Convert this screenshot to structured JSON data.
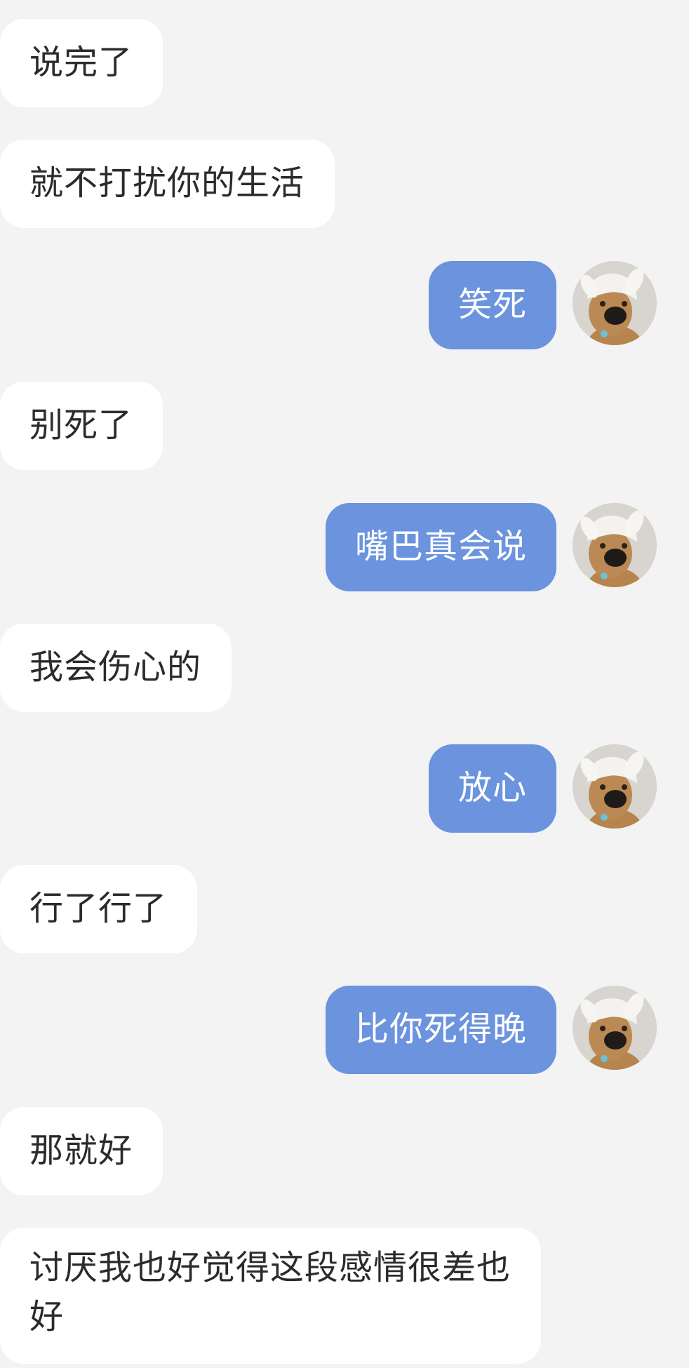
{
  "messages": [
    {
      "side": "incoming",
      "text": "说完了"
    },
    {
      "side": "incoming",
      "text": "就不打扰你的生活"
    },
    {
      "side": "outgoing",
      "text": "笑死"
    },
    {
      "side": "incoming",
      "text": "别死了"
    },
    {
      "side": "outgoing",
      "text": "嘴巴真会说"
    },
    {
      "side": "incoming",
      "text": "我会伤心的"
    },
    {
      "side": "outgoing",
      "text": "放心"
    },
    {
      "side": "incoming",
      "text": "行了行了"
    },
    {
      "side": "outgoing",
      "text": "比你死得晚"
    },
    {
      "side": "incoming",
      "text": "那就好"
    },
    {
      "side": "incoming",
      "text": "讨厌我也好觉得这段感情很差也好"
    }
  ],
  "colors": {
    "background": "#f3f3f3",
    "incoming_bubble": "#ffffff",
    "outgoing_bubble": "#6b93de",
    "incoming_text": "#2b2b2b",
    "outgoing_text": "#ffffff"
  },
  "avatar": {
    "icon": "bunny-hat-plush-dog-avatar"
  }
}
